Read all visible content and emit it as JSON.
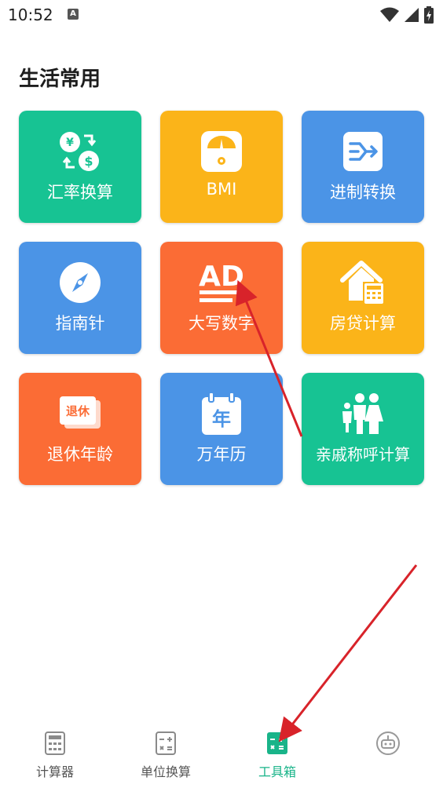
{
  "status": {
    "time": "10:52",
    "notif_letter": "A"
  },
  "section": {
    "title": "生活常用"
  },
  "tools": [
    {
      "label": "汇率换算",
      "icon": "currency-exchange-icon",
      "color": "#17c393"
    },
    {
      "label": "BMI",
      "icon": "scale-icon",
      "color": "#fbb419"
    },
    {
      "label": "进制转换",
      "icon": "binary-convert-icon",
      "color": "#4b94e6"
    },
    {
      "label": "指南针",
      "icon": "compass-icon",
      "color": "#4b94e6"
    },
    {
      "label": "大写数字",
      "icon": "ad-icon",
      "color": "#fb6c35"
    },
    {
      "label": "房贷计算",
      "icon": "house-calculator-icon",
      "color": "#fbb419"
    },
    {
      "label": "退休年龄",
      "icon": "retire-icon",
      "color": "#fb6c35"
    },
    {
      "label": "万年历",
      "icon": "calendar-icon",
      "color": "#4b94e6"
    },
    {
      "label": "亲戚称呼计算",
      "icon": "family-icon",
      "color": "#17c393"
    }
  ],
  "icon_text": {
    "currency_yuan": "¥",
    "currency_dollar": "$",
    "ad": "AD",
    "retire": "退休",
    "calendar_year": "年"
  },
  "tabs": [
    {
      "label": "计算器",
      "icon": "calculator-icon",
      "active": false
    },
    {
      "label": "单位换算",
      "icon": "unit-convert-icon",
      "active": false
    },
    {
      "label": "工具箱",
      "icon": "toolbox-icon",
      "active": true
    },
    {
      "label": "",
      "icon": "robot-icon",
      "active": false
    }
  ],
  "colors": {
    "accent": "#19b489",
    "annotation_arrow": "#d8232a"
  }
}
